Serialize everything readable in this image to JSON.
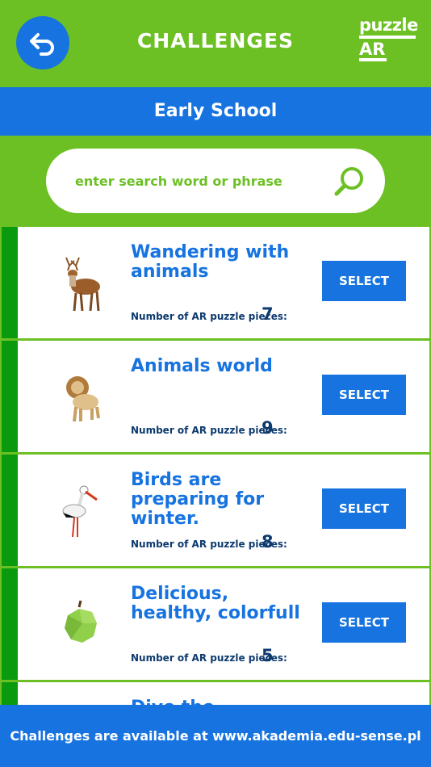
{
  "header": {
    "title": "CHALLENGES",
    "logo_line1": "puzzle",
    "logo_line2": "AR"
  },
  "subheader": {
    "label": "Early School"
  },
  "search": {
    "placeholder": "enter search word or phrase",
    "value": ""
  },
  "pieces_label": "Number of AR puzzle pieces:",
  "select_label": "SELECT",
  "cards": [
    {
      "title": "Wandering with animals",
      "pieces": "7",
      "icon": "deer-icon"
    },
    {
      "title": "Animals world",
      "pieces": "9",
      "icon": "lion-icon"
    },
    {
      "title": "Birds are preparing for winter.",
      "pieces": "8",
      "icon": "stork-icon"
    },
    {
      "title": "Delicious, healthy, colorfull",
      "pieces": "5",
      "icon": "apple-icon"
    },
    {
      "title": "Dive the",
      "pieces": "",
      "icon": "extra-badge-icon"
    }
  ],
  "footer": {
    "text": "Challenges are available at www.akademia.edu-sense.pl"
  },
  "colors": {
    "green": "#6cc024",
    "blue": "#1673e0",
    "dark_green": "#0a9a0e",
    "navy": "#0d3a6e"
  }
}
